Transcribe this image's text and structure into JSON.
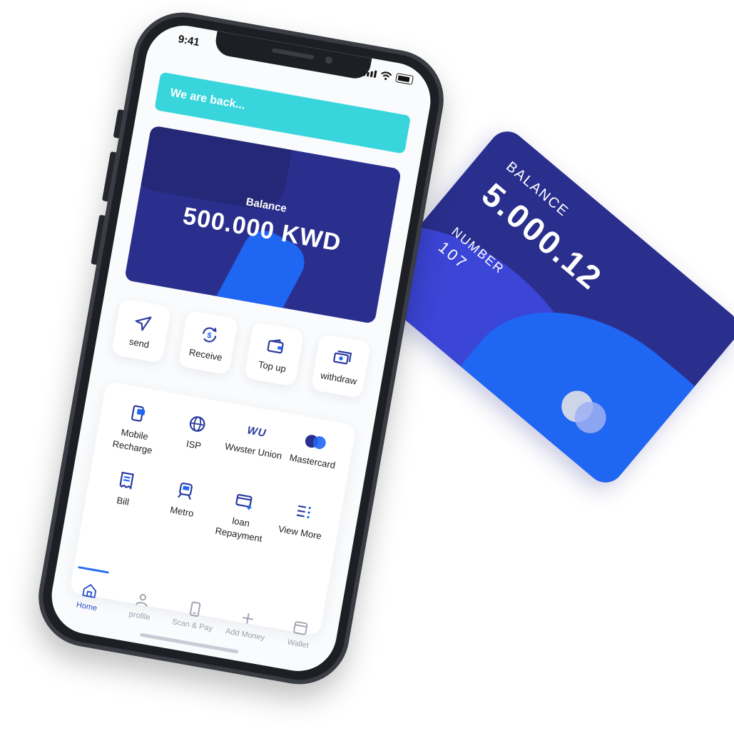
{
  "card": {
    "balance_label": "BALANCE",
    "balance_value": "5.000.12",
    "number_label": "NUMBER",
    "number_value": "107"
  },
  "status_bar": {
    "time": "9:41"
  },
  "banner": {
    "text": "We are back..."
  },
  "balance": {
    "label": "Balance",
    "amount": "500.000 KWD"
  },
  "actions": [
    {
      "label": "send",
      "icon": "send-icon"
    },
    {
      "label": "Receive",
      "icon": "receive-icon"
    },
    {
      "label": "Top up",
      "icon": "wallet-icon"
    },
    {
      "label": "withdraw",
      "icon": "cash-icon"
    }
  ],
  "services": [
    {
      "label": "Mobile Recharge",
      "icon": "mobile-recharge-icon"
    },
    {
      "label": "ISP",
      "icon": "globe-icon"
    },
    {
      "label": "Wwster Union",
      "icon": "western-union-logo",
      "logo_text": "WU"
    },
    {
      "label": "Mastercard",
      "icon": "mastercard-logo"
    },
    {
      "label": "Bill",
      "icon": "receipt-icon"
    },
    {
      "label": "Metro",
      "icon": "train-icon"
    },
    {
      "label": "loan Repayment",
      "icon": "card-add-icon"
    },
    {
      "label": "View More",
      "icon": "list-icon"
    }
  ],
  "tabs": [
    {
      "label": "Home",
      "icon": "home-icon",
      "active": true
    },
    {
      "label": "profile",
      "icon": "user-icon"
    },
    {
      "label": "Scan & Pay",
      "icon": "phone-icon"
    },
    {
      "label": "Add Money",
      "icon": "plus-icon"
    },
    {
      "label": "Wallet",
      "icon": "wallet-icon"
    }
  ],
  "colors": {
    "navy": "#2a2f8e",
    "blue": "#1f66f2",
    "teal": "#38d6dc",
    "accent_tab": "#2a6cf0"
  }
}
